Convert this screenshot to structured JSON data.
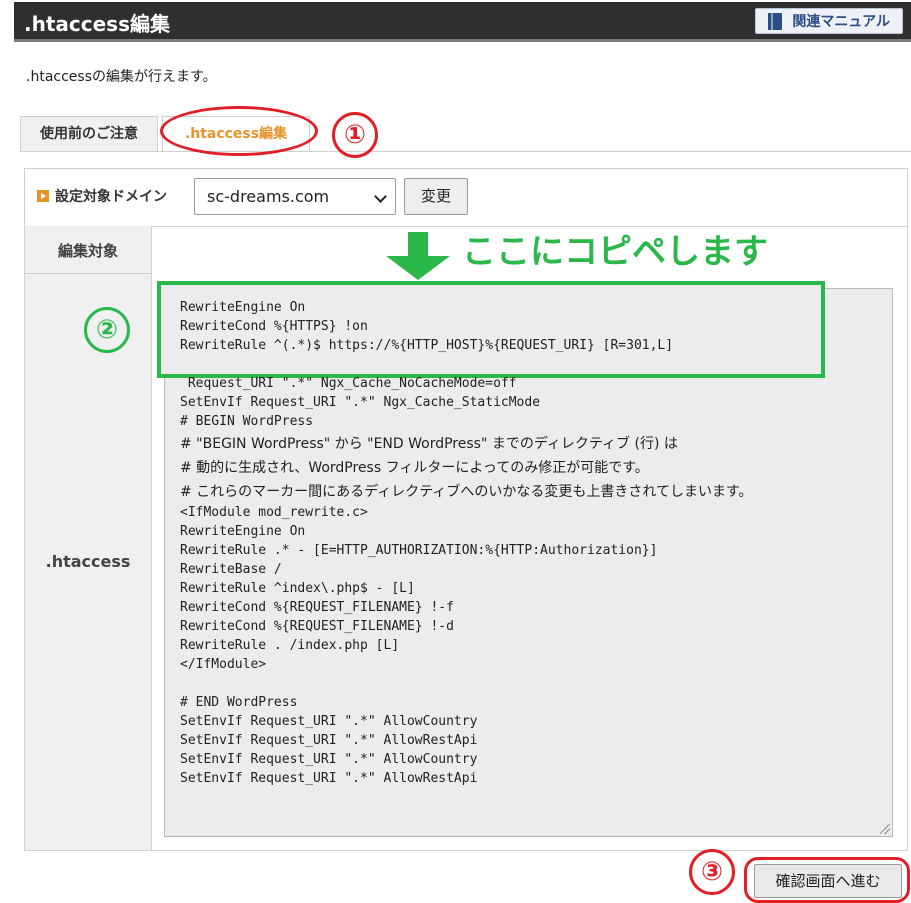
{
  "header": {
    "title": ".htaccess編集",
    "manual_button": "関連マニュアル"
  },
  "description": ".htaccessの編集が行えます。",
  "tabs": [
    {
      "label": "使用前のご注意",
      "active": false
    },
    {
      "label": ".htaccess編集",
      "active": true
    }
  ],
  "annotations": {
    "step1": "①",
    "step2": "②",
    "step3": "③",
    "copy_here": "ここにコピペします",
    "highlight_color": "#e01f26",
    "green_color": "#2ab84a"
  },
  "domain": {
    "label": "設定対象ドメイン",
    "selected": "sc-dreams.com",
    "change_button": "変更"
  },
  "form": {
    "edit_target_label": "編集対象",
    "htaccess_label": ".htaccess"
  },
  "editor": {
    "lines": [
      "RewriteEngine On",
      "RewriteCond %{HTTPS} !on",
      "RewriteRule ^(.*)$ https://%{HTTP_HOST}%{REQUEST_URI} [R=301,L]",
      " Request_URI \".*\" Ngx_Cache_NoCacheMode=off",
      "SetEnvIf Request_URI \".*\" Ngx_Cache_StaticMode",
      "# BEGIN WordPress",
      "# \"BEGIN WordPress\" から \"END WordPress\" までのディレクティブ (行) は",
      "# 動的に生成され、WordPress フィルターによってのみ修正が可能です。",
      "# これらのマーカー間にあるディレクティブへのいかなる変更も上書きされてしまいます。",
      "<IfModule mod_rewrite.c>",
      "RewriteEngine On",
      "RewriteRule .* - [E=HTTP_AUTHORIZATION:%{HTTP:Authorization}]",
      "RewriteBase /",
      "RewriteRule ^index\\.php$ - [L]",
      "RewriteCond %{REQUEST_FILENAME} !-f",
      "RewriteCond %{REQUEST_FILENAME} !-d",
      "RewriteRule . /index.php [L]",
      "</IfModule>",
      "",
      "# END WordPress",
      "SetEnvIf Request_URI \".*\" AllowCountry",
      "SetEnvIf Request_URI \".*\" AllowRestApi",
      "SetEnvIf Request_URI \".*\" AllowCountry",
      "SetEnvIf Request_URI \".*\" AllowRestApi"
    ]
  },
  "confirm_button": "確認画面へ進む"
}
